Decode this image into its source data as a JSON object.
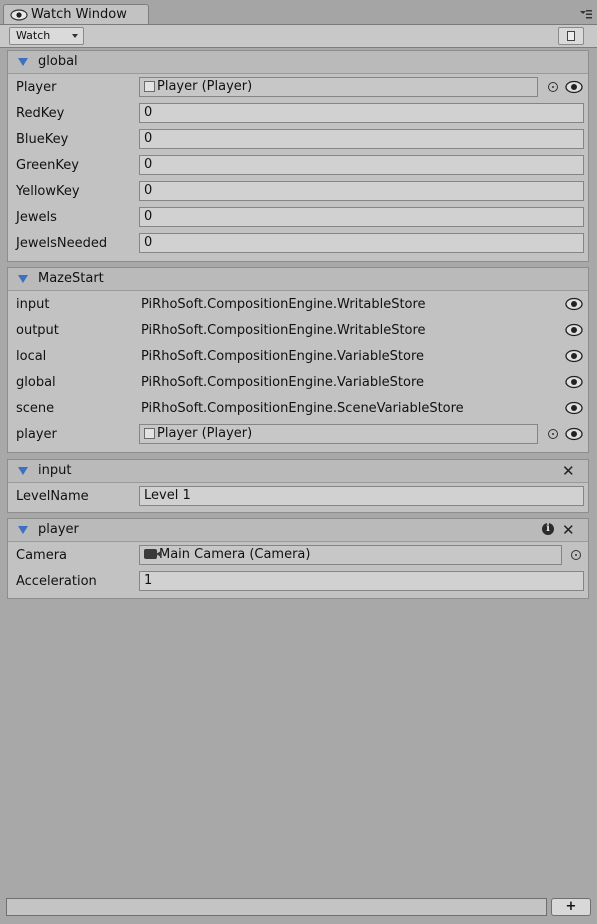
{
  "window": {
    "tab_title": "Watch Window"
  },
  "toolbar": {
    "dropdown_label": "Watch"
  },
  "sections": {
    "global": {
      "title": "global",
      "rows": [
        {
          "label": "Player",
          "value": "Player (Player)"
        },
        {
          "label": "RedKey",
          "value": "0"
        },
        {
          "label": "BlueKey",
          "value": "0"
        },
        {
          "label": "GreenKey",
          "value": "0"
        },
        {
          "label": "YellowKey",
          "value": "0"
        },
        {
          "label": "Jewels",
          "value": "0"
        },
        {
          "label": "JewelsNeeded",
          "value": "0"
        }
      ]
    },
    "mazestart": {
      "title": "MazeStart",
      "rows": [
        {
          "label": "input",
          "value": "PiRhoSoft.CompositionEngine.WritableStore"
        },
        {
          "label": "output",
          "value": "PiRhoSoft.CompositionEngine.WritableStore"
        },
        {
          "label": "local",
          "value": "PiRhoSoft.CompositionEngine.VariableStore"
        },
        {
          "label": "global",
          "value": "PiRhoSoft.CompositionEngine.VariableStore"
        },
        {
          "label": "scene",
          "value": "PiRhoSoft.CompositionEngine.SceneVariableStore"
        },
        {
          "label": "player",
          "value": "Player (Player)"
        }
      ]
    },
    "input": {
      "title": "input",
      "rows": [
        {
          "label": "LevelName",
          "value": "Level 1"
        }
      ]
    },
    "player": {
      "title": "player",
      "rows": [
        {
          "label": "Camera",
          "value": "Main Camera (Camera)"
        },
        {
          "label": "Acceleration",
          "value": "1"
        }
      ]
    }
  },
  "footer": {
    "add_label": "+"
  },
  "icons": {
    "tab": "eye-icon",
    "watch": "eye-icon",
    "picker": "object-picker-icon",
    "close": "close-icon",
    "info": "info-icon",
    "collapse": "triangle-down-icon"
  },
  "colors": {
    "accent": "#3f6fc1",
    "panel": "#c2c2c2",
    "background": "#a8a8a8"
  }
}
